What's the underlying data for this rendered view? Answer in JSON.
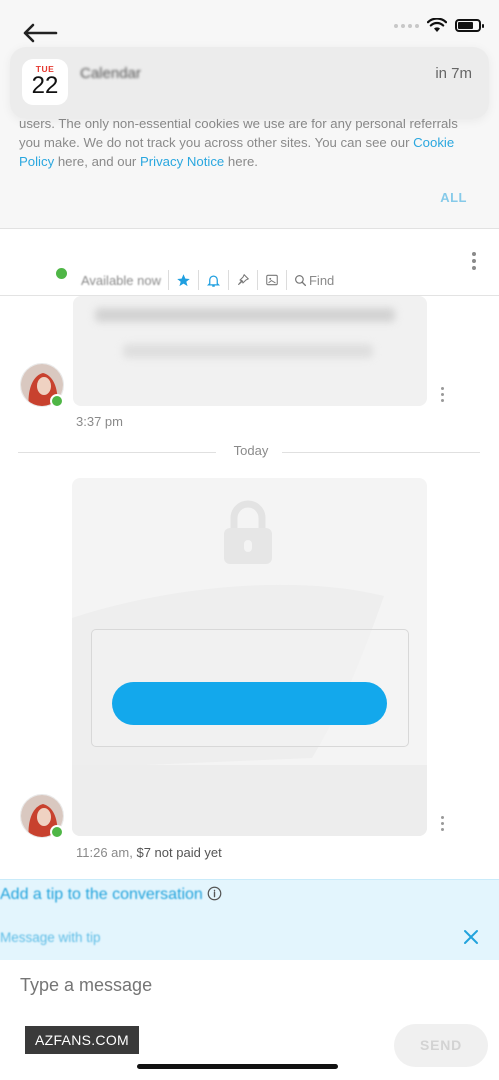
{
  "notification": {
    "app_name": "Calendar",
    "time": "in 7m",
    "weekday": "TUE",
    "date": "22"
  },
  "cookie": {
    "text_before_link": "users. The only non-essential cookies we use are for any personal referrals you make. We do not track you across other sites. You can see our ",
    "cookie_policy_link": "Cookie Policy",
    "text_middle": " here, and our ",
    "privacy_link": "Privacy Notice",
    "text_after": " here.",
    "accept_label": "ALL"
  },
  "chat_header": {
    "status": "Available now",
    "find_label": "Find"
  },
  "messages": [
    {
      "time": "3:37 pm"
    },
    {
      "time": "11:26 am,",
      "price_note": "$7 not paid yet"
    }
  ],
  "day_separator": "Today",
  "tip_banner": {
    "line1": "Add a tip to the conversation",
    "line2": "Message with tip"
  },
  "composer": {
    "placeholder": "Type a message",
    "send_label": "SEND"
  },
  "watermark": "AZFANS.COM",
  "colors": {
    "accent": "#13a8ec",
    "online": "#4fb646",
    "tip_bg": "#e3f5fd"
  }
}
